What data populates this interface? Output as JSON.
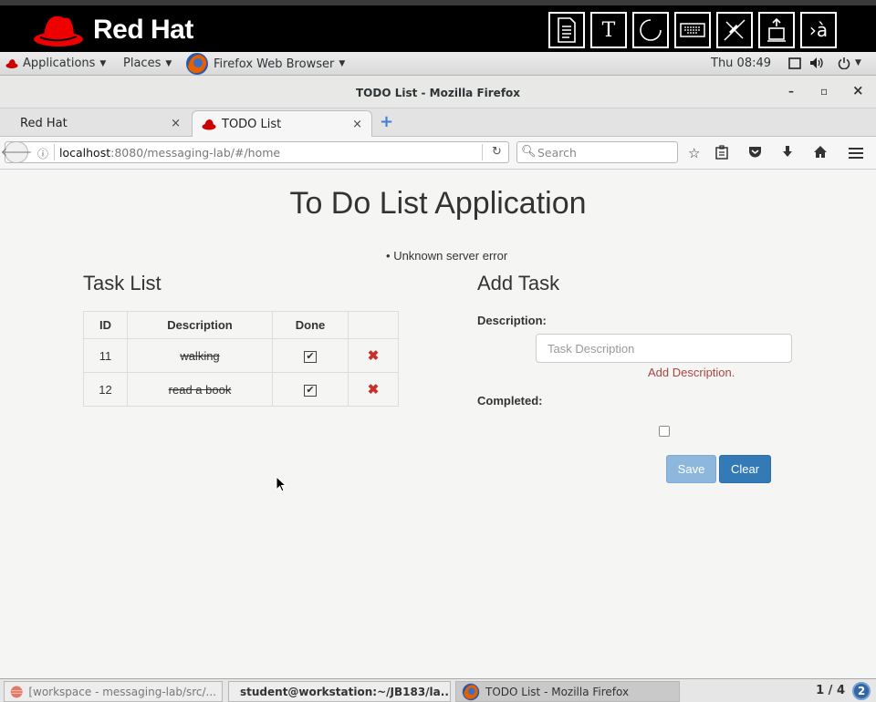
{
  "banner": {
    "logo_text": "Red Hat",
    "tools": [
      "document-icon",
      "text-icon",
      "circle-icon",
      "keyboard-icon",
      "mute-icon",
      "eject-icon",
      "language-icon"
    ],
    "tool_text_label": "T",
    "tool_lang_label": "›à"
  },
  "topbar": {
    "applications": "Applications",
    "places": "Places",
    "app_menu": "Firefox Web Browser",
    "clock": "Thu 08:49"
  },
  "window": {
    "title": "TODO List - Mozilla Firefox",
    "minimize": "–",
    "maximize": "▫",
    "close": "×"
  },
  "tabs": [
    {
      "label": "Red Hat",
      "close": "×"
    },
    {
      "label": "TODO List",
      "close": "×"
    }
  ],
  "new_tab": "+",
  "navbar": {
    "url_host": "localhost",
    "url_rest": ":8080/messaging-lab/#/home",
    "search_placeholder": "Search"
  },
  "page": {
    "title": "To Do List Application",
    "error_message": "Unknown server error",
    "task_list_heading": "Task List",
    "add_task_heading": "Add Task",
    "table": {
      "headers": [
        "ID",
        "Description",
        "Done",
        ""
      ],
      "rows": [
        {
          "id": "11",
          "description": "walking",
          "done": true
        },
        {
          "id": "12",
          "description": "read a book",
          "done": true
        }
      ]
    },
    "form": {
      "description_label": "Description:",
      "description_placeholder": "Task Description",
      "description_error": "Add Description.",
      "completed_label": "Completed:",
      "completed": false,
      "save_label": "Save",
      "clear_label": "Clear"
    }
  },
  "taskbar": {
    "items": [
      "[workspace - messaging-lab/src/...",
      "student@workstation:~/JB183/la...",
      "TODO List - Mozilla Firefox"
    ],
    "workspace": "1 / 4",
    "notifications": "2"
  }
}
